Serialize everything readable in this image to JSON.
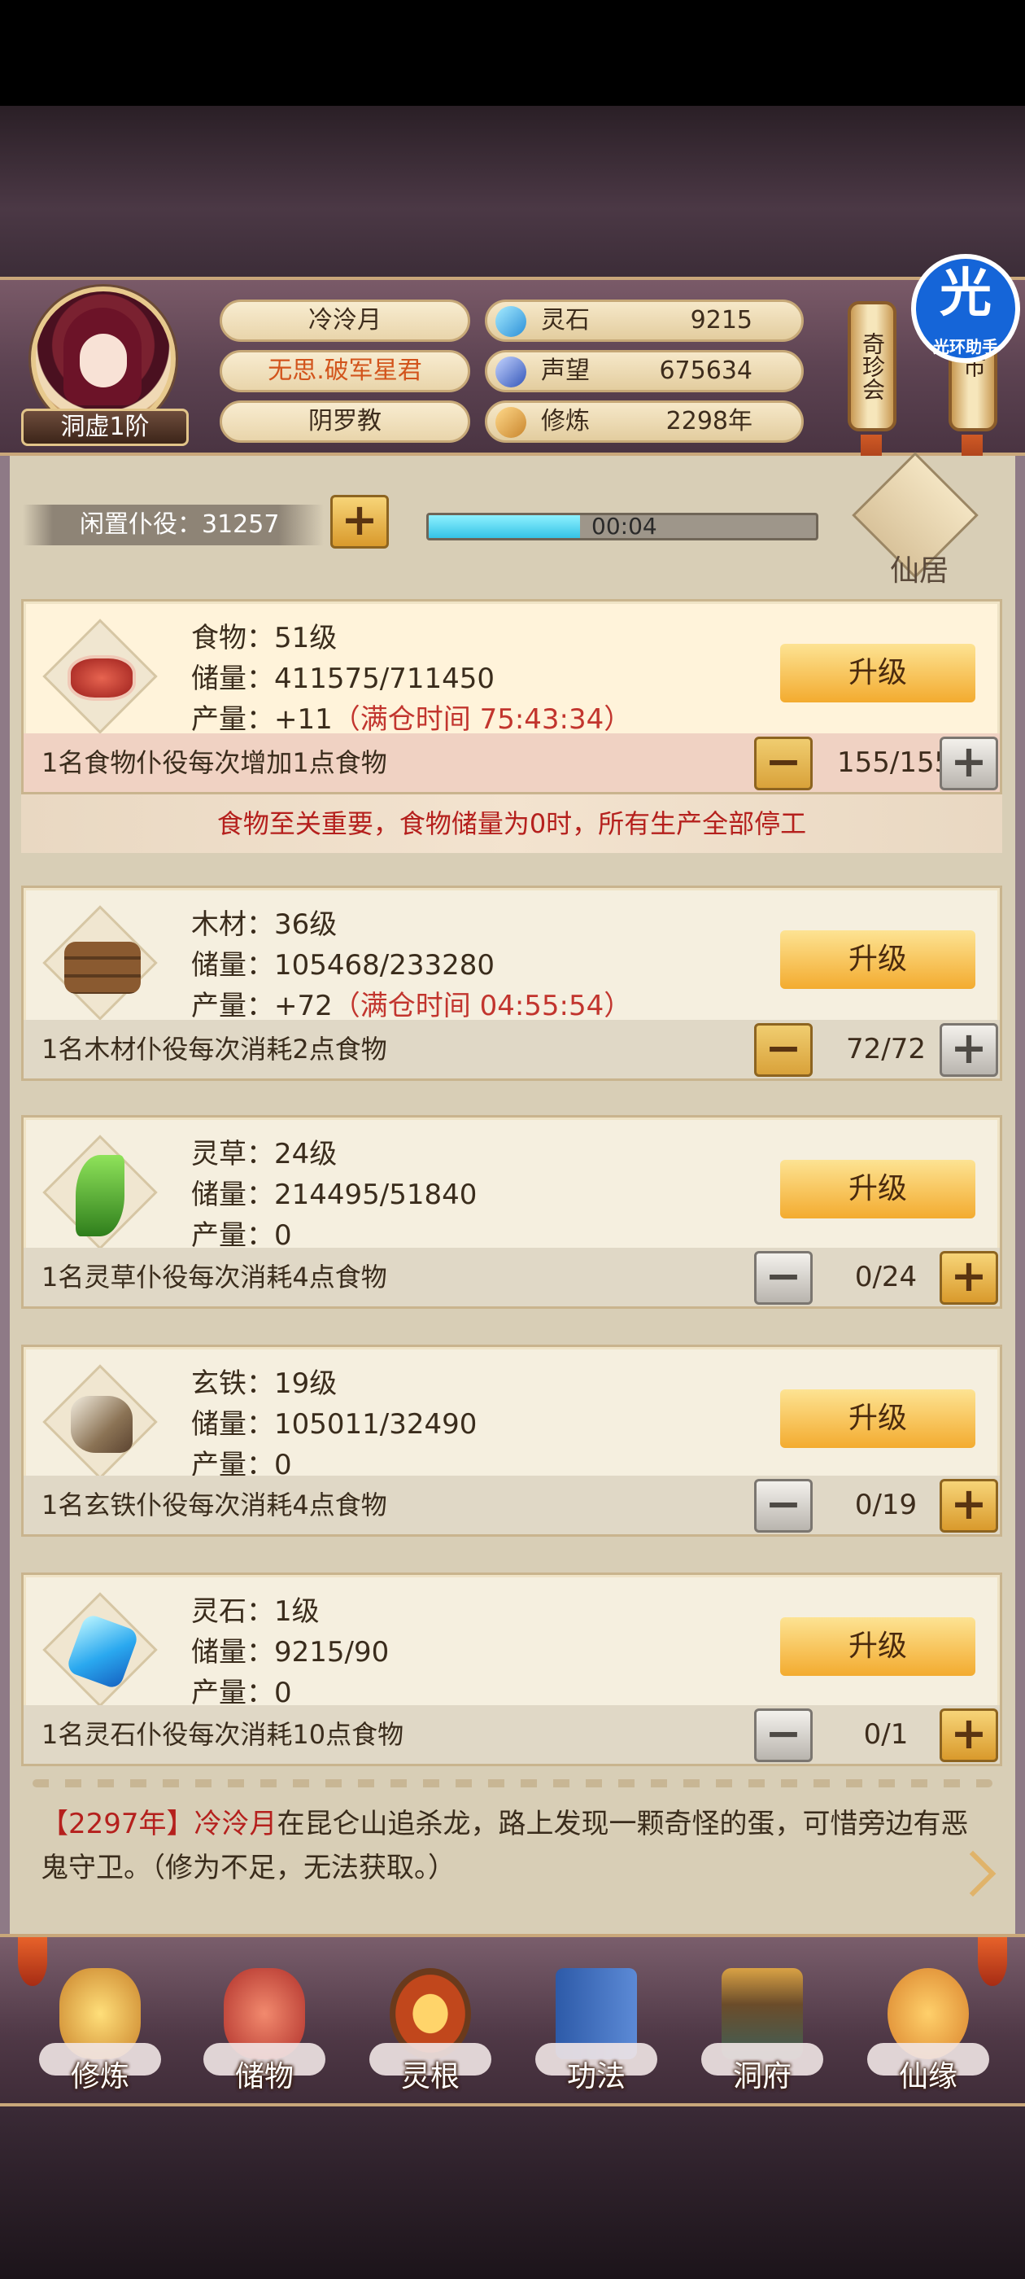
{
  "player": {
    "name": "冷泠月",
    "title": "无思.破军星君",
    "sect": "阴罗教",
    "rank": "洞虚1阶"
  },
  "resources": [
    {
      "label": "灵石",
      "value": "9215",
      "icon": "spirit-stone-icon"
    },
    {
      "label": "声望",
      "value": "675634",
      "icon": "reputation-icon"
    },
    {
      "label": "修炼",
      "value": "2298年",
      "icon": "cultivation-icon"
    }
  ],
  "side_buttons": {
    "treasure": "奇珍会",
    "market": "市"
  },
  "overlay_badge": {
    "char": "光",
    "label": "光环助手"
  },
  "idle": {
    "label": "闲置仆役：31257",
    "timer": "00:04",
    "progress": 0.39
  },
  "xianju": {
    "label": "仙居"
  },
  "upgrade_label": "升级",
  "warning": "食物至关重要，食物储量为0时，所有生产全部停工",
  "cards": [
    {
      "name": "食物：51级",
      "storage": "储量：411575/711450",
      "prod": "产量：+11",
      "full": "（满仓时间 75:43:34）",
      "desc": "1名食物仆役每次增加1点食物",
      "count": "155/155",
      "icon": "meat-icon"
    },
    {
      "name": "木材：36级",
      "storage": "储量：105468/233280",
      "prod": "产量：+72",
      "full": "（满仓时间 04:55:54）",
      "desc": "1名木材仆役每次消耗2点食物",
      "count": "72/72",
      "icon": "wood-icon"
    },
    {
      "name": "灵草：24级",
      "storage": "储量：214495/51840",
      "prod": "产量：0",
      "full": "",
      "desc": "1名灵草仆役每次消耗4点食物",
      "count": "0/24",
      "icon": "herb-icon"
    },
    {
      "name": "玄铁：19级",
      "storage": "储量：105011/32490",
      "prod": "产量：0",
      "full": "",
      "desc": "1名玄铁仆役每次消耗4点食物",
      "count": "0/19",
      "icon": "iron-ore-icon"
    },
    {
      "name": "灵石：1级",
      "storage": "储量：9215/90",
      "prod": "产量：0",
      "full": "",
      "desc": "1名灵石仆役每次消耗10点食物",
      "count": "0/1",
      "icon": "spirit-crystal-icon"
    }
  ],
  "log": {
    "year": "【2297年】",
    "name": "冷泠月",
    "text": "在昆仑山追杀龙，路上发现一颗奇怪的蛋，可惜旁边有恶鬼守卫。（修为不足，无法获取。）"
  },
  "nav": [
    {
      "label": "修炼",
      "icon": "cultivation-monk-icon"
    },
    {
      "label": "储物",
      "icon": "storage-bag-icon"
    },
    {
      "label": "灵根",
      "icon": "spirit-root-icon"
    },
    {
      "label": "功法",
      "icon": "technique-book-icon"
    },
    {
      "label": "洞府",
      "icon": "cave-mansion-icon"
    },
    {
      "label": "仙缘",
      "icon": "destiny-gourd-icon"
    }
  ]
}
